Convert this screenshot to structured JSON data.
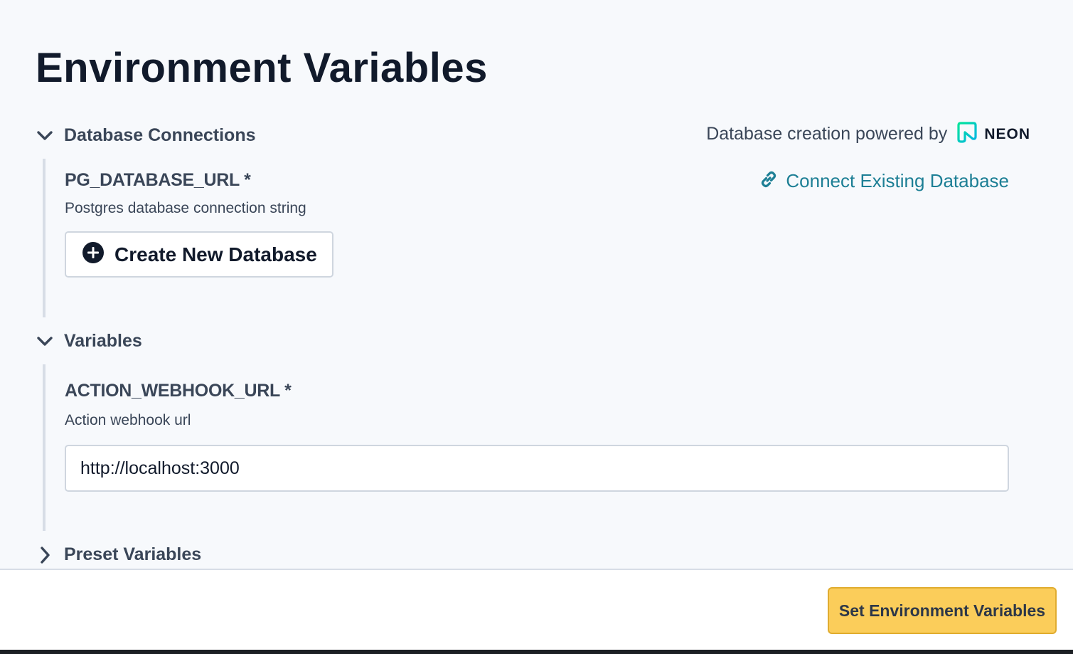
{
  "page": {
    "title": "Environment Variables"
  },
  "database_section": {
    "label": "Database Connections",
    "expanded": true,
    "powered_by_text": "Database creation powered by",
    "powered_by_brand": "NEON",
    "connect_link_label": "Connect Existing Database",
    "variable": {
      "name": "PG_DATABASE_URL *",
      "description": "Postgres database connection string"
    },
    "create_button_label": "Create New Database"
  },
  "variables_section": {
    "label": "Variables",
    "expanded": true,
    "variable": {
      "name": "ACTION_WEBHOOK_URL *",
      "description": "Action webhook url",
      "value": "http://localhost:3000"
    }
  },
  "preset_section": {
    "label": "Preset Variables",
    "expanded": false
  },
  "footer": {
    "submit_label": "Set Environment Variables"
  },
  "colors": {
    "accent_link": "#1d7f95",
    "primary_button": "#fbcd5a",
    "neon_gradient_start": "#00e599",
    "neon_gradient_end": "#00b3e6"
  },
  "icons": {
    "collapse": "chevron-down-icon",
    "expand": "chevron-right-icon",
    "create": "plus-circle-icon",
    "link": "link-icon",
    "brand": "neon-logo-icon"
  }
}
